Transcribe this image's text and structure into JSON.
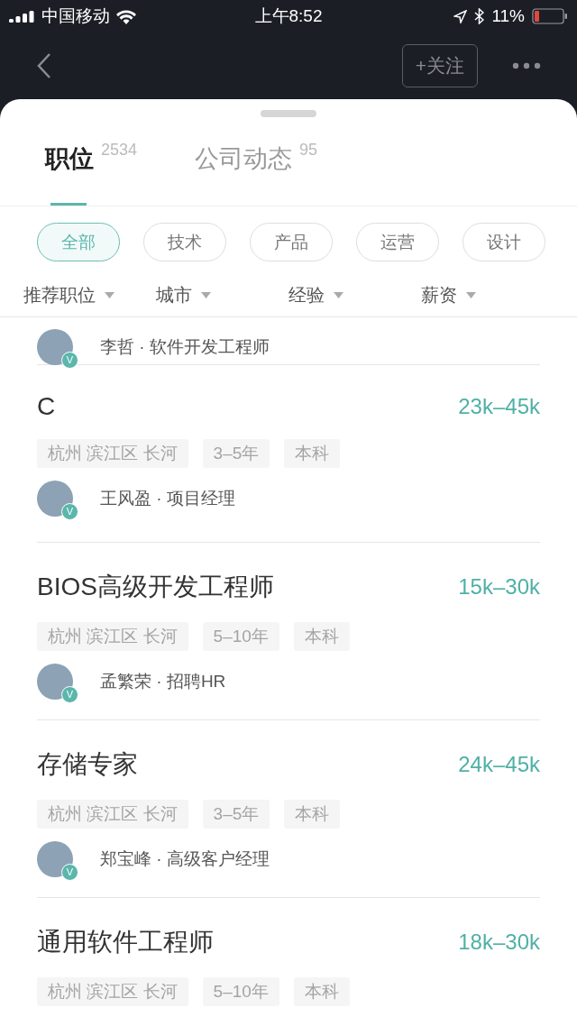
{
  "status_bar": {
    "carrier": "中国移动",
    "time": "上午8:52",
    "battery": "11%"
  },
  "nav": {
    "follow_button": "+关注"
  },
  "tabs": [
    {
      "label": "职位",
      "count": "2534",
      "selected": true
    },
    {
      "label": "公司动态",
      "count": "95",
      "selected": false
    }
  ],
  "categories": [
    {
      "label": "全部",
      "selected": true
    },
    {
      "label": "技术",
      "selected": false
    },
    {
      "label": "产品",
      "selected": false
    },
    {
      "label": "运营",
      "selected": false
    },
    {
      "label": "设计",
      "selected": false
    }
  ],
  "filters": [
    "推荐职位",
    "城市",
    "经验",
    "薪资"
  ],
  "partial_job": {
    "recruiter": "李哲 · 软件开发工程师",
    "badge": "V"
  },
  "jobs": [
    {
      "title": "C",
      "salary": "23k–45k",
      "tags": [
        "杭州 滨江区 长河",
        "3–5年",
        "本科"
      ],
      "recruiter": "王风盈 · 项目经理",
      "badge": "V"
    },
    {
      "title": "BIOS高级开发工程师",
      "salary": "15k–30k",
      "tags": [
        "杭州 滨江区 长河",
        "5–10年",
        "本科"
      ],
      "recruiter": "孟繁荣 · 招聘HR",
      "badge": "V"
    },
    {
      "title": "存储专家",
      "salary": "24k–45k",
      "tags": [
        "杭州 滨江区 长河",
        "3–5年",
        "本科"
      ],
      "recruiter": "郑宝峰 · 高级客户经理",
      "badge": "V"
    },
    {
      "title": "通用软件工程师",
      "salary": "18k–30k",
      "tags": [
        "杭州 滨江区 长河",
        "5–10年",
        "本科"
      ]
    }
  ]
}
